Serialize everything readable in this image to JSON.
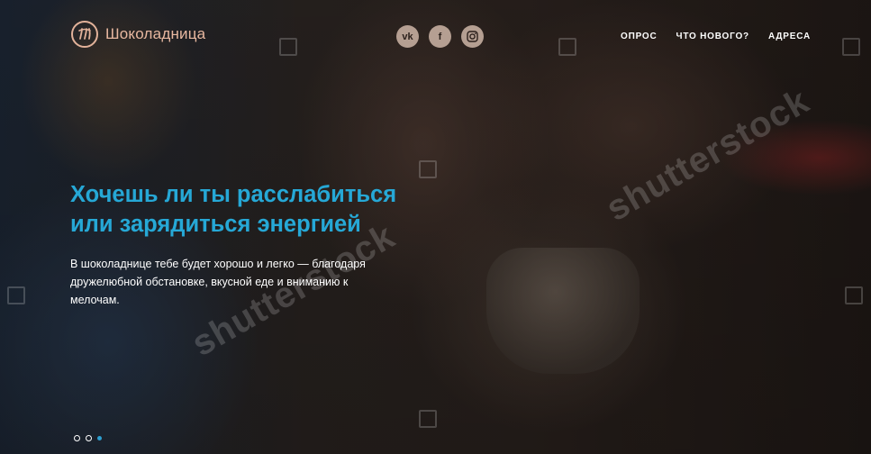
{
  "brand": {
    "name": "Шоколадница",
    "color": "#e8b8a0"
  },
  "socials": [
    {
      "label": "vk",
      "icon": "vk-icon"
    },
    {
      "label": "f",
      "icon": "facebook-icon"
    },
    {
      "label": "",
      "icon": "instagram-icon"
    }
  ],
  "nav": {
    "items": [
      "ОПРОС",
      "ЧТО НОВОГО?",
      "АДРЕСА"
    ]
  },
  "hero": {
    "headline_line1": "Хочешь ли ты расслабиться",
    "headline_line2": "или зарядиться энергией",
    "description": "В шоколаднице тебе будет хорошо и легко — благодаря дружелюбной обстановке, вкусной еде и вниманию к мелочам.",
    "accent": "#26a8d6"
  },
  "slider": {
    "total": 3,
    "active": 3
  },
  "watermark": {
    "text": "shutterstock"
  }
}
